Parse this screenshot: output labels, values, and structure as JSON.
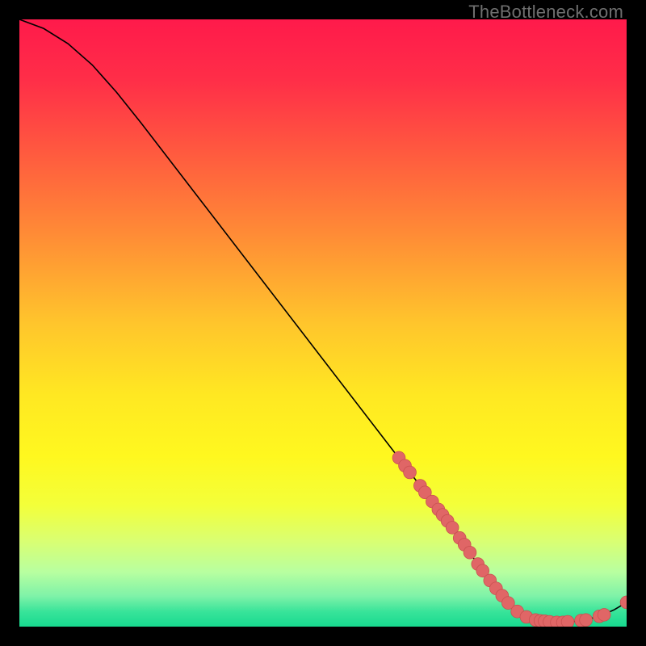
{
  "watermark": "TheBottleneck.com",
  "colors": {
    "background": "#000000",
    "curve": "#000000",
    "marker_fill": "#e06666",
    "marker_stroke": "#c84f4f"
  },
  "chart_data": {
    "type": "line",
    "title": "",
    "xlabel": "",
    "ylabel": "",
    "xlim": [
      0,
      100
    ],
    "ylim": [
      0,
      100
    ],
    "grid": false,
    "gradient_stops": [
      {
        "offset": 0.0,
        "color": "#ff1a4b"
      },
      {
        "offset": 0.1,
        "color": "#ff2e48"
      },
      {
        "offset": 0.22,
        "color": "#ff5a3f"
      },
      {
        "offset": 0.35,
        "color": "#ff8a36"
      },
      {
        "offset": 0.5,
        "color": "#ffc52c"
      },
      {
        "offset": 0.62,
        "color": "#ffe822"
      },
      {
        "offset": 0.72,
        "color": "#fff81f"
      },
      {
        "offset": 0.8,
        "color": "#f3ff3a"
      },
      {
        "offset": 0.86,
        "color": "#d9ff73"
      },
      {
        "offset": 0.91,
        "color": "#b8ffa0"
      },
      {
        "offset": 0.95,
        "color": "#7ef2a8"
      },
      {
        "offset": 0.975,
        "color": "#39e49a"
      },
      {
        "offset": 1.0,
        "color": "#17d98f"
      }
    ],
    "curve": [
      {
        "x": 0.0,
        "y": 100.0
      },
      {
        "x": 4.0,
        "y": 98.5
      },
      {
        "x": 8.0,
        "y": 96.0
      },
      {
        "x": 12.0,
        "y": 92.5
      },
      {
        "x": 16.0,
        "y": 88.0
      },
      {
        "x": 20.0,
        "y": 83.0
      },
      {
        "x": 30.0,
        "y": 70.0
      },
      {
        "x": 40.0,
        "y": 57.0
      },
      {
        "x": 50.0,
        "y": 44.0
      },
      {
        "x": 60.0,
        "y": 31.0
      },
      {
        "x": 65.0,
        "y": 24.5
      },
      {
        "x": 70.0,
        "y": 18.0
      },
      {
        "x": 75.0,
        "y": 11.0
      },
      {
        "x": 78.0,
        "y": 7.0
      },
      {
        "x": 80.0,
        "y": 4.5
      },
      {
        "x": 82.0,
        "y": 2.5
      },
      {
        "x": 84.0,
        "y": 1.4
      },
      {
        "x": 86.0,
        "y": 0.9
      },
      {
        "x": 88.0,
        "y": 0.7
      },
      {
        "x": 90.0,
        "y": 0.7
      },
      {
        "x": 92.0,
        "y": 0.9
      },
      {
        "x": 94.0,
        "y": 1.3
      },
      {
        "x": 96.0,
        "y": 1.9
      },
      {
        "x": 98.0,
        "y": 2.8
      },
      {
        "x": 100.0,
        "y": 4.0
      }
    ],
    "markers": [
      {
        "x": 62.5,
        "y": 27.8
      },
      {
        "x": 63.5,
        "y": 26.5
      },
      {
        "x": 64.3,
        "y": 25.4
      },
      {
        "x": 66.0,
        "y": 23.2
      },
      {
        "x": 66.8,
        "y": 22.1
      },
      {
        "x": 68.0,
        "y": 20.6
      },
      {
        "x": 69.0,
        "y": 19.3
      },
      {
        "x": 69.7,
        "y": 18.4
      },
      {
        "x": 70.5,
        "y": 17.4
      },
      {
        "x": 71.3,
        "y": 16.3
      },
      {
        "x": 72.5,
        "y": 14.6
      },
      {
        "x": 73.3,
        "y": 13.5
      },
      {
        "x": 74.2,
        "y": 12.2
      },
      {
        "x": 75.5,
        "y": 10.3
      },
      {
        "x": 76.3,
        "y": 9.2
      },
      {
        "x": 77.5,
        "y": 7.6
      },
      {
        "x": 78.5,
        "y": 6.3
      },
      {
        "x": 79.5,
        "y": 5.1
      },
      {
        "x": 80.5,
        "y": 3.9
      },
      {
        "x": 82.0,
        "y": 2.5
      },
      {
        "x": 83.5,
        "y": 1.6
      },
      {
        "x": 85.0,
        "y": 1.1
      },
      {
        "x": 85.8,
        "y": 0.95
      },
      {
        "x": 86.5,
        "y": 0.9
      },
      {
        "x": 87.3,
        "y": 0.8
      },
      {
        "x": 88.5,
        "y": 0.7
      },
      {
        "x": 89.5,
        "y": 0.7
      },
      {
        "x": 90.3,
        "y": 0.8
      },
      {
        "x": 92.5,
        "y": 1.0
      },
      {
        "x": 93.3,
        "y": 1.1
      },
      {
        "x": 95.5,
        "y": 1.7
      },
      {
        "x": 96.3,
        "y": 1.95
      },
      {
        "x": 100.0,
        "y": 4.0
      }
    ]
  }
}
